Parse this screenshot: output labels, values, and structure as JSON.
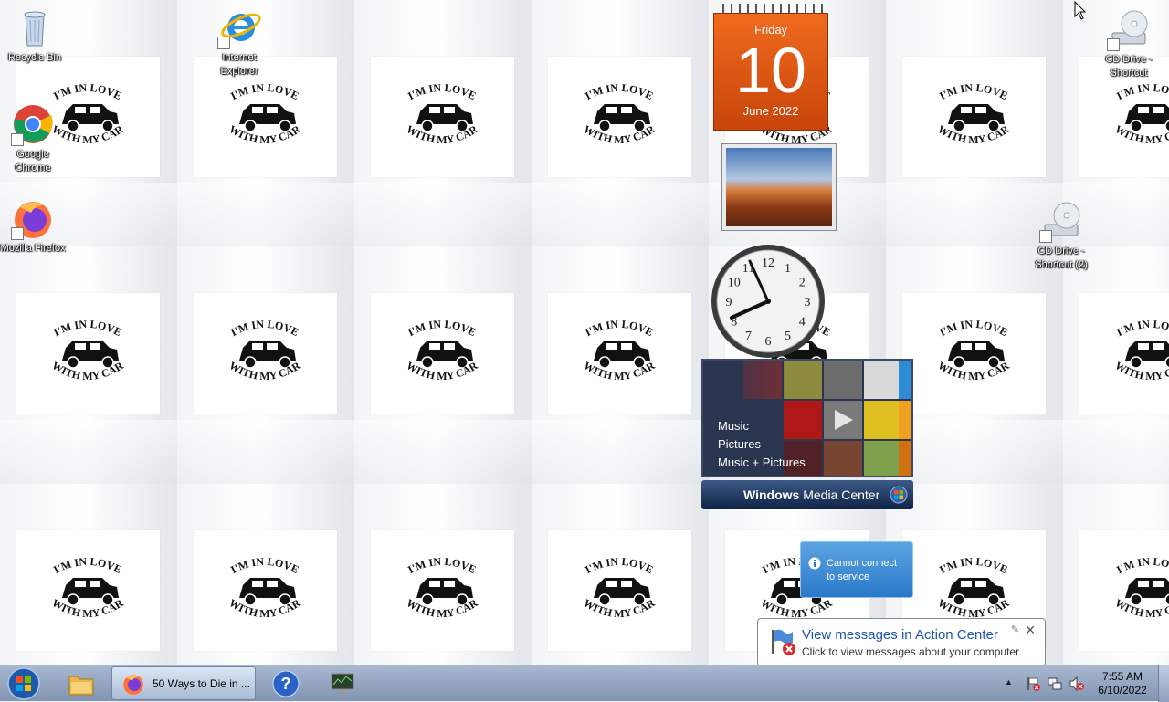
{
  "desktop": {
    "icons": [
      {
        "label": "Recycle Bin"
      },
      {
        "label": "Internet Explorer"
      },
      {
        "label": "Google Chrome"
      },
      {
        "label": "Mozilla Firefox"
      },
      {
        "label": "CD Drive - Shortcut"
      },
      {
        "label": "CD Drive - Shortcut (2)"
      }
    ],
    "wallpaper_tile_text_top": "I'M IN LOVE",
    "wallpaper_tile_text_bottom": "WITH MY CAR"
  },
  "gadgets": {
    "calendar": {
      "weekday": "Friday",
      "day": "10",
      "month_year": "June 2022"
    },
    "clock": {
      "numerals": [
        "12",
        "1",
        "2",
        "3",
        "4",
        "5",
        "6",
        "7",
        "8",
        "9",
        "10",
        "11"
      ]
    },
    "media_center": {
      "menu": [
        "Music",
        "Pictures",
        "Music + Pictures"
      ],
      "brand_bold": "Windows",
      "brand_light": "Media Center"
    }
  },
  "notifications": {
    "service": {
      "text_line1": "Cannot connect",
      "text_line2": "to service"
    },
    "action_center": {
      "title": "View messages in Action Center",
      "body": "Click to view messages about your computer.",
      "close": "✕"
    }
  },
  "taskbar": {
    "firefox_task_label": "50 Ways to Die in ...",
    "clock_time": "7:55 AM",
    "clock_date": "6/10/2022",
    "tray_arrow": "▲"
  },
  "colors": {
    "calendar_orange": "#e85f16",
    "taskbar": "#8a9dbb",
    "action_title": "#1f54a8"
  }
}
